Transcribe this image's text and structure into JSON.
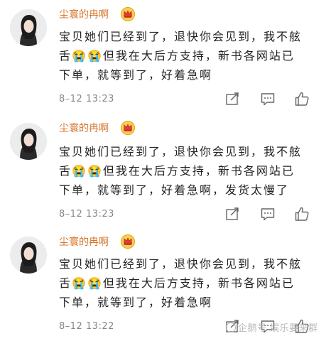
{
  "comments": [
    {
      "username": "尘寰的冉啊",
      "lines": [
        "宝贝她们已经到了，退快你会见到，我不舷",
        "舌|😭😭|但我在大后方支持，新书各网站已",
        "下单，就等到了，好着急啊"
      ],
      "time": "8–12  13:23"
    },
    {
      "username": "尘寰的冉啊",
      "lines": [
        "宝贝她们已经到了，退快你会见到，我不舷",
        "舌|😭😭|但我在大后方支持，新书各网站已",
        "下单，就等到了，好着急啊，发货太慢了"
      ],
      "time": "8–12  13:23"
    },
    {
      "username": "尘寰的冉啊",
      "lines": [
        "宝贝她们已经到了，退快你会见到，我不舷",
        "舌|😭😭|但我在大后方支持，新书各网站已",
        "下单，就等到了，好着急啊"
      ],
      "time": "8–12  13:22"
    }
  ],
  "watermark": "企鹅号 娱乐要来群",
  "icons": {
    "crown": "crown-icon",
    "share": "share-edit-icon",
    "comment": "comment-icon",
    "like": "thumbs-up-icon",
    "emoji": "crying-face-emoji"
  },
  "colors": {
    "username": "#d6762c",
    "meta": "#888888",
    "crown": "#e0a21a"
  }
}
